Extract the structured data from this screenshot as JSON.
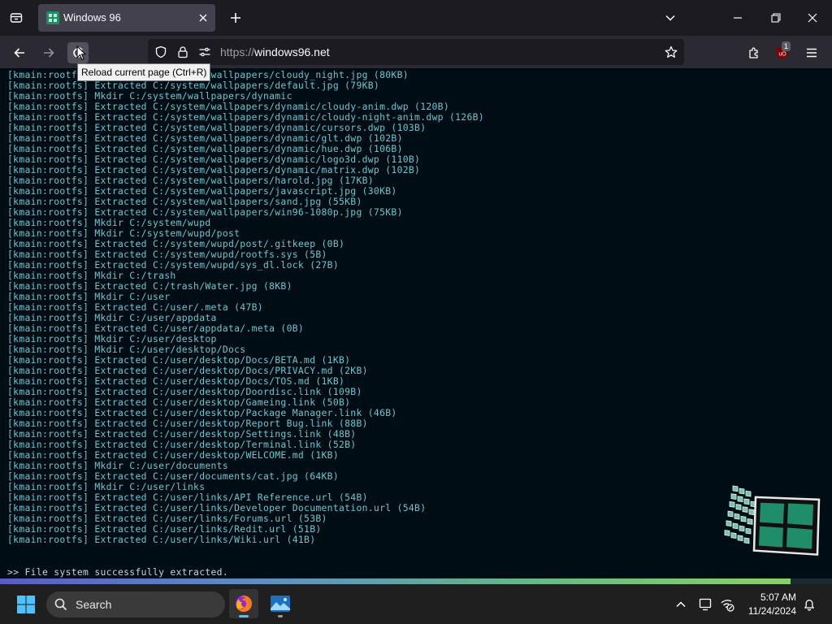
{
  "browser": {
    "tab_title": "Windows 96",
    "url_scheme": "https://",
    "url_host": "windows96.net",
    "extension_badge": "1",
    "tooltip": "Reload current page (Ctrl+R)"
  },
  "terminal": {
    "lines": [
      "[kmain:rootfs] Extracted C:/system/wallpapers/cloudy_night.jpg (80KB)",
      "[kmain:rootfs] Extracted C:/system/wallpapers/default.jpg (79KB)",
      "[kmain:rootfs] Mkdir C:/system/wallpapers/dynamic",
      "[kmain:rootfs] Extracted C:/system/wallpapers/dynamic/cloudy-anim.dwp (120B)",
      "[kmain:rootfs] Extracted C:/system/wallpapers/dynamic/cloudy-night-anim.dwp (126B)",
      "[kmain:rootfs] Extracted C:/system/wallpapers/dynamic/cursors.dwp (103B)",
      "[kmain:rootfs] Extracted C:/system/wallpapers/dynamic/glt.dwp (102B)",
      "[kmain:rootfs] Extracted C:/system/wallpapers/dynamic/hue.dwp (106B)",
      "[kmain:rootfs] Extracted C:/system/wallpapers/dynamic/logo3d.dwp (110B)",
      "[kmain:rootfs] Extracted C:/system/wallpapers/dynamic/matrix.dwp (102B)",
      "[kmain:rootfs] Extracted C:/system/wallpapers/harold.jpg (17KB)",
      "[kmain:rootfs] Extracted C:/system/wallpapers/javascript.jpg (30KB)",
      "[kmain:rootfs] Extracted C:/system/wallpapers/sand.jpg (55KB)",
      "[kmain:rootfs] Extracted C:/system/wallpapers/win96-1080p.jpg (75KB)",
      "[kmain:rootfs] Mkdir C:/system/wupd",
      "[kmain:rootfs] Mkdir C:/system/wupd/post",
      "[kmain:rootfs] Extracted C:/system/wupd/post/.gitkeep (0B)",
      "[kmain:rootfs] Extracted C:/system/wupd/rootfs.sys (5B)",
      "[kmain:rootfs] Extracted C:/system/wupd/sys_dl.lock (27B)",
      "[kmain:rootfs] Mkdir C:/trash",
      "[kmain:rootfs] Extracted C:/trash/Water.jpg (8KB)",
      "[kmain:rootfs] Mkdir C:/user",
      "[kmain:rootfs] Extracted C:/user/.meta (47B)",
      "[kmain:rootfs] Mkdir C:/user/appdata",
      "[kmain:rootfs] Extracted C:/user/appdata/.meta (0B)",
      "[kmain:rootfs] Mkdir C:/user/desktop",
      "[kmain:rootfs] Mkdir C:/user/desktop/Docs",
      "[kmain:rootfs] Extracted C:/user/desktop/Docs/BETA.md (1KB)",
      "[kmain:rootfs] Extracted C:/user/desktop/Docs/PRIVACY.md (2KB)",
      "[kmain:rootfs] Extracted C:/user/desktop/Docs/TOS.md (1KB)",
      "[kmain:rootfs] Extracted C:/user/desktop/Doordisc.link (109B)",
      "[kmain:rootfs] Extracted C:/user/desktop/Gameing.link (50B)",
      "[kmain:rootfs] Extracted C:/user/desktop/Package Manager.link (46B)",
      "[kmain:rootfs] Extracted C:/user/desktop/Report Bug.link (88B)",
      "[kmain:rootfs] Extracted C:/user/desktop/Settings.link (48B)",
      "[kmain:rootfs] Extracted C:/user/desktop/Terminal.link (52B)",
      "[kmain:rootfs] Extracted C:/user/desktop/WELCOME.md (1KB)",
      "[kmain:rootfs] Mkdir C:/user/documents",
      "[kmain:rootfs] Extracted C:/user/documents/cat.jpg (64KB)",
      "[kmain:rootfs] Mkdir C:/user/links",
      "[kmain:rootfs] Extracted C:/user/links/API Reference.url (54B)",
      "[kmain:rootfs] Extracted C:/user/links/Developer Documentation.url (54B)",
      "[kmain:rootfs] Extracted C:/user/links/Forums.url (53B)",
      "[kmain:rootfs] Extracted C:/user/links/Redit.url (51B)",
      "[kmain:rootfs] Extracted C:/user/links/Wiki.url (41B)"
    ],
    "final_message": ">> File system successfully extracted.",
    "progress": 0.95
  },
  "taskbar": {
    "search_label": "Search",
    "time": "5:07 AM",
    "date": "11/24/2024"
  },
  "colors": {
    "terminal_text": "#6bc6d0",
    "terminal_bg": "#000d14",
    "logo_green": "#1f8c6a"
  }
}
